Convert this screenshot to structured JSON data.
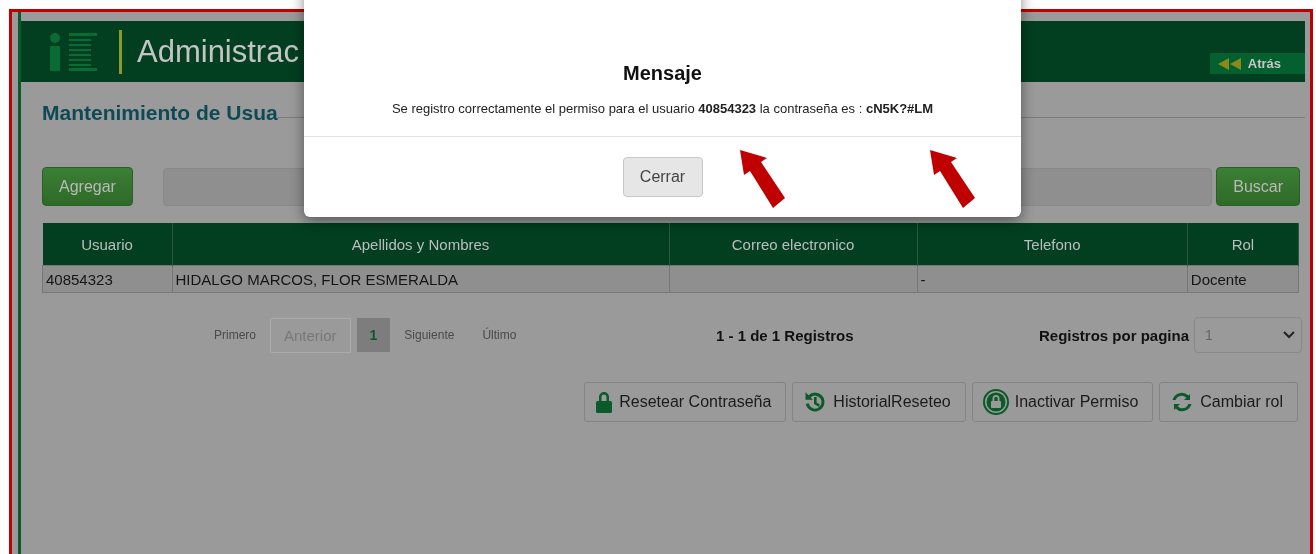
{
  "header": {
    "title": "Administrac",
    "back_link": "Atrás"
  },
  "page_title": "Mantenimiento de Usua",
  "add_button": "Agregar",
  "search_button": "Buscar",
  "table": {
    "columns": [
      "Usuario",
      "Apellidos y Nombres",
      "Correo electronico",
      "Telefono",
      "Rol"
    ],
    "rows": [
      {
        "cells": [
          "40854323",
          "HIDALGO MARCOS, FLOR ESMERALDA",
          null,
          "-",
          "Docente"
        ]
      }
    ]
  },
  "pagination": {
    "first": "Primero",
    "previous": "Anterior",
    "pages": [
      {
        "label": "1",
        "selected": true
      }
    ],
    "next": "Siguiente",
    "last": "Último"
  },
  "summary": "1 - 1 de 1 Registros",
  "per_page": {
    "label": "Registros por pagina",
    "value": "1"
  },
  "actions": [
    {
      "kind": "lock",
      "label": "Resetear Contraseña"
    },
    {
      "kind": "history",
      "label": "HistorialReseteo"
    },
    {
      "kind": "circle-lock",
      "label": "Inactivar Permiso"
    },
    {
      "kind": "refresh",
      "label": "Cambiar rol"
    }
  ],
  "modal": {
    "title": "Mensaje",
    "message": "Se registro correctamente el permiso para el usuario **40854323** la contraseña es : **cN5K?#LM**",
    "close_button": "Cerrar"
  }
}
